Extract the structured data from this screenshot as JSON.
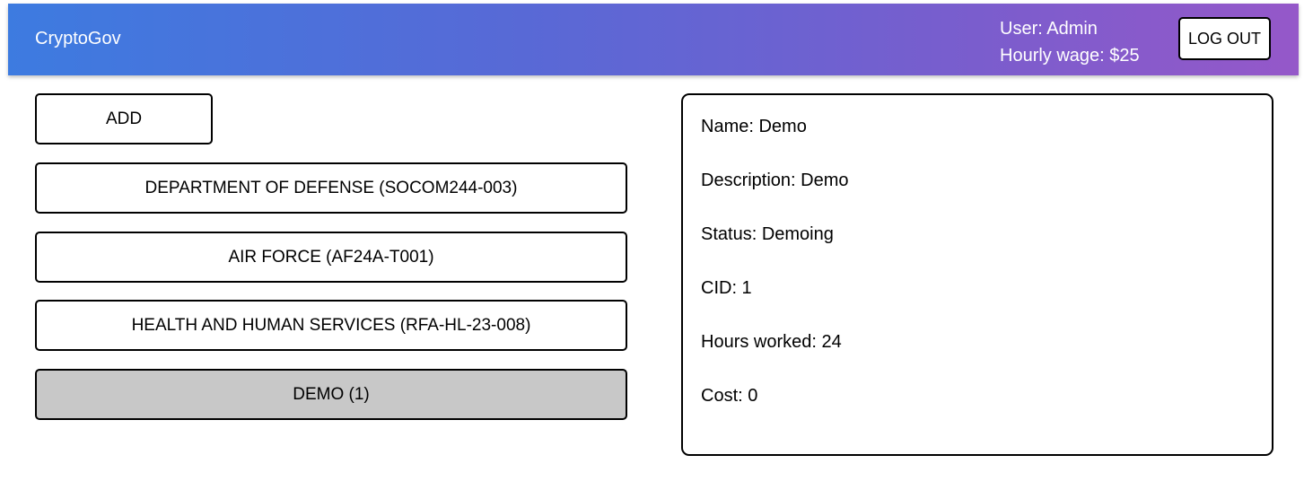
{
  "header": {
    "brand": "CryptoGov",
    "user": "User: Admin",
    "wage": "Hourly wage: $25",
    "logout_label": "LOG OUT"
  },
  "list": {
    "add_label": "ADD",
    "items": [
      {
        "label": "DEPARTMENT OF DEFENSE (SOCOM244-003)",
        "selected": false
      },
      {
        "label": "AIR FORCE (AF24A-T001)",
        "selected": false
      },
      {
        "label": "HEALTH AND HUMAN SERVICES (RFA-HL-23-008)",
        "selected": false
      },
      {
        "label": "DEMO (1)",
        "selected": true
      }
    ]
  },
  "details": {
    "name": "Name: Demo",
    "description": "Description: Demo",
    "status": "Status: Demoing",
    "cid": "CID: 1",
    "hours": "Hours worked: 24",
    "cost": "Cost: 0"
  },
  "colors": {
    "header_gradient_start": "#3d7be0",
    "header_gradient_end": "#9558c9",
    "selected_item_bg": "#c8c8c8"
  }
}
